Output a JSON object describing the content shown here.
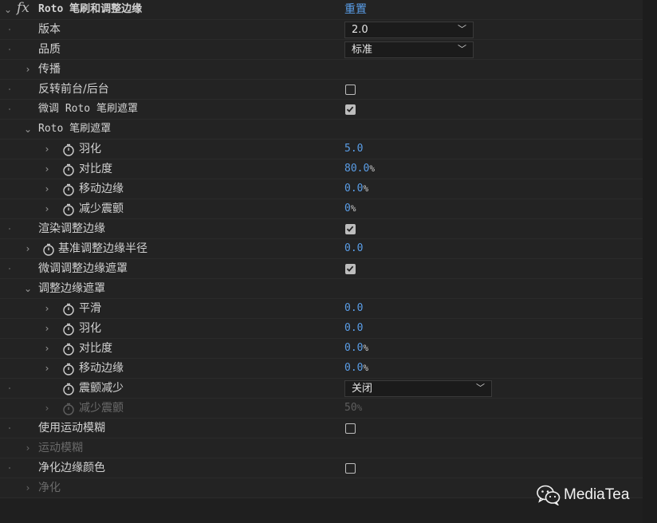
{
  "effect": {
    "name": "Roto 笔刷和调整边缘",
    "reset_label": "重置"
  },
  "rows": {
    "version": {
      "label": "版本",
      "value": "2.0"
    },
    "quality": {
      "label": "品质",
      "value": "标准"
    },
    "propagation": {
      "label": "传播"
    },
    "invert": {
      "label": "反转前台/后台",
      "checked": false
    },
    "refine_roto": {
      "label": "微调 Roto 笔刷遮罩",
      "checked": true
    },
    "roto_matte": {
      "label": "Roto 笔刷遮罩"
    },
    "rm_feather": {
      "label": "羽化",
      "value": "5.0",
      "unit": ""
    },
    "rm_contrast": {
      "label": "对比度",
      "value": "80.0",
      "unit": "%"
    },
    "rm_shift": {
      "label": "移动边缘",
      "value": "0.0",
      "unit": "%"
    },
    "rm_chatter": {
      "label": "减少震颤",
      "value": "0",
      "unit": "%"
    },
    "render_edge": {
      "label": "渲染调整边缘",
      "checked": true
    },
    "base_radius": {
      "label": "基准调整边缘半径",
      "value": "0.0"
    },
    "refine_edge_matte_cb": {
      "label": "微调调整边缘遮罩",
      "checked": true
    },
    "edge_matte": {
      "label": "调整边缘遮罩"
    },
    "em_smooth": {
      "label": "平滑",
      "value": "0.0",
      "unit": ""
    },
    "em_feather": {
      "label": "羽化",
      "value": "0.0",
      "unit": ""
    },
    "em_contrast": {
      "label": "对比度",
      "value": "0.0",
      "unit": "%"
    },
    "em_shift": {
      "label": "移动边缘",
      "value": "0.0",
      "unit": "%"
    },
    "em_chatter_mode": {
      "label": "震颤减少",
      "value": "关闭"
    },
    "em_chatter": {
      "label": "减少震颤",
      "value": "50",
      "unit": "%"
    },
    "motion_blur": {
      "label": "使用运动模糊",
      "checked": false
    },
    "motion_blur_group": {
      "label": "运动模糊"
    },
    "decontaminate": {
      "label": "净化边缘颜色",
      "checked": false
    },
    "decontam_group": {
      "label": "净化"
    }
  },
  "watermark": {
    "text": "MediaTea",
    "icon": "wechat-icon"
  }
}
